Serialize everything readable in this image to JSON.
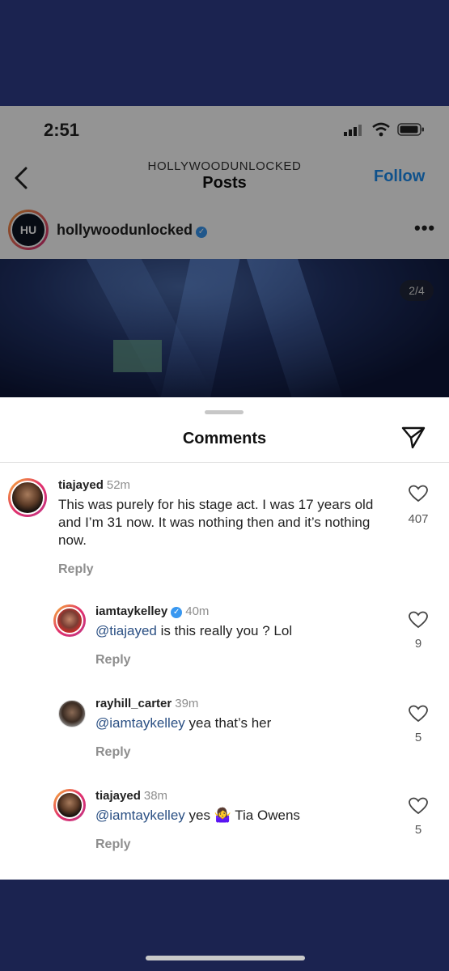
{
  "status": {
    "time": "2:51"
  },
  "nav": {
    "subtitle": "HOLLYWOODUNLOCKED",
    "title": "Posts",
    "follow": "Follow"
  },
  "account": {
    "name": "hollywoodunlocked",
    "avatar_text": "HU"
  },
  "media": {
    "counter": "2/4"
  },
  "comments_sheet": {
    "title": "Comments",
    "reply_label": "Reply",
    "comments": [
      {
        "user": "tiajayed",
        "time": "52m",
        "text": "This was purely for his stage act. I was 17 years old and I’m 31 now. It was nothing then and it’s nothing now.",
        "likes": "407"
      },
      {
        "user": "iamtaykelley",
        "time": "40m",
        "mention": "@tiajayed",
        "text": " is this really you ? Lol",
        "likes": "9"
      },
      {
        "user": "rayhill_carter",
        "time": "39m",
        "mention": "@iamtaykelley",
        "text": " yea that’s her",
        "likes": "5"
      },
      {
        "user": "tiajayed",
        "time": "38m",
        "mention": "@iamtaykelley",
        "text": " yes 🤷‍♀️ Tia Owens",
        "likes": "5"
      }
    ]
  },
  "colors": {
    "accent": "#1a8cf0",
    "mention": "#2a4f83",
    "background": "#1b2350"
  }
}
